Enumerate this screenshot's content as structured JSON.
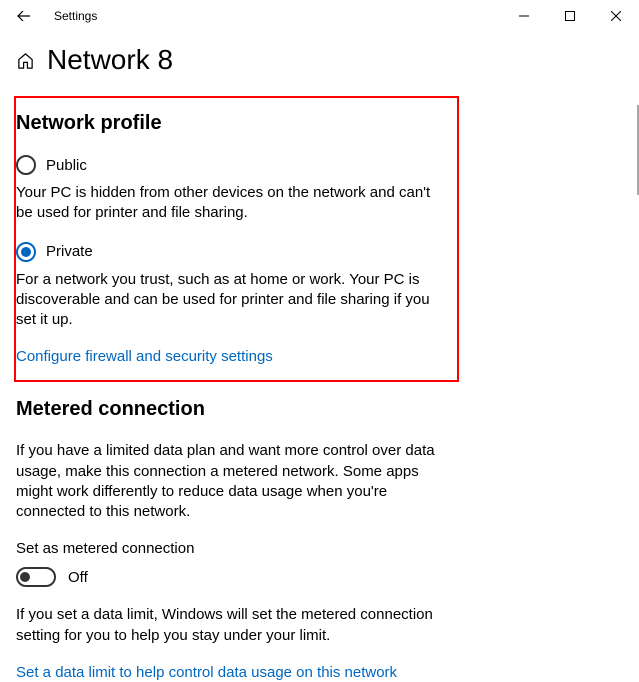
{
  "window": {
    "title": "Settings"
  },
  "page": {
    "title": "Network 8"
  },
  "network_profile": {
    "heading": "Network profile",
    "options": [
      {
        "label": "Public",
        "desc": "Your PC is hidden from other devices on the network and can't be used for printer and file sharing.",
        "selected": false
      },
      {
        "label": "Private",
        "desc": "For a network you trust, such as at home or work. Your PC is discoverable and can be used for printer and file sharing if you set it up.",
        "selected": true
      }
    ],
    "link": "Configure firewall and security settings"
  },
  "metered": {
    "heading": "Metered connection",
    "desc": "If you have a limited data plan and want more control over data usage, make this connection a metered network. Some apps might work differently to reduce data usage when you're connected to this network.",
    "toggle_heading": "Set as metered connection",
    "toggle_state": "Off",
    "limit_desc": "If you set a data limit, Windows will set the metered connection setting for you to help you stay under your limit.",
    "link": "Set a data limit to help control data usage on this network"
  }
}
